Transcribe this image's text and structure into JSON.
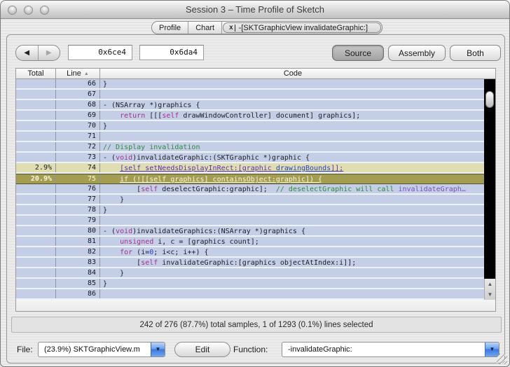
{
  "window": {
    "title": "Session 3 – Time Profile of Sketch"
  },
  "tabs": {
    "profile_label": "Profile",
    "chart_label": "Chart",
    "active_label": "-[SKTGraphicView invalidateGraphic:]",
    "close_icon": "x"
  },
  "nav": {
    "back_icon": "◀",
    "forward_icon": "▶",
    "start_address": "0x6ce4",
    "end_address": "0x6da4",
    "source_label": "Source",
    "assembly_label": "Assembly",
    "both_label": "Both"
  },
  "table": {
    "headers": {
      "total": "Total",
      "line": "Line",
      "sort_icon": "▲",
      "code": "Code"
    },
    "rows": [
      {
        "line": "66",
        "total": "",
        "style": "normal",
        "segs": [
          {
            "t": "}",
            "s": "p"
          }
        ]
      },
      {
        "line": "67",
        "total": "",
        "style": "normal",
        "segs": []
      },
      {
        "line": "68",
        "total": "",
        "style": "normal",
        "segs": [
          {
            "t": "- (NSArray *)graphics {",
            "s": "p"
          }
        ]
      },
      {
        "line": "69",
        "total": "",
        "style": "normal",
        "segs": [
          {
            "t": "    ",
            "s": "p"
          },
          {
            "t": "return",
            "s": "k"
          },
          {
            "t": " [[[",
            "s": "p"
          },
          {
            "t": "self",
            "s": "k"
          },
          {
            "t": " drawWindowController] document] graphics];",
            "s": "p"
          }
        ]
      },
      {
        "line": "70",
        "total": "",
        "style": "normal",
        "segs": [
          {
            "t": "}",
            "s": "p"
          }
        ]
      },
      {
        "line": "71",
        "total": "",
        "style": "normal",
        "segs": []
      },
      {
        "line": "72",
        "total": "",
        "style": "normal",
        "segs": [
          {
            "t": "// Display invalidation",
            "s": "c"
          }
        ]
      },
      {
        "line": "73",
        "total": "",
        "style": "normal",
        "segs": [
          {
            "t": "- (",
            "s": "p"
          },
          {
            "t": "void",
            "s": "k"
          },
          {
            "t": ")invalidateGraphic:(SKTGraphic *)graphic {",
            "s": "p"
          }
        ]
      },
      {
        "line": "74",
        "total": "2.9%",
        "style": "hot",
        "segs": [
          {
            "t": "    ",
            "s": "p"
          },
          {
            "t": "[self setNeedsDisplayInRect:[graphic ",
            "s": "u"
          },
          {
            "t": "drawingBounds",
            "s": "ub"
          },
          {
            "t": "]];",
            "s": "u"
          }
        ]
      },
      {
        "line": "75",
        "total": "20.9%",
        "style": "sel",
        "segs": [
          {
            "t": "    ",
            "s": "p"
          },
          {
            "t": "if (![[self graphics] containsObject:graphic]) {",
            "s": "su"
          }
        ]
      },
      {
        "line": "76",
        "total": "",
        "style": "normal",
        "segs": [
          {
            "t": "        [",
            "s": "p"
          },
          {
            "t": "self",
            "s": "k"
          },
          {
            "t": " deselectGraphic:graphic];  ",
            "s": "p"
          },
          {
            "t": "// deselectGraphic will call ",
            "s": "c"
          },
          {
            "t": "invalidateGraph…",
            "s": "v"
          }
        ]
      },
      {
        "line": "77",
        "total": "",
        "style": "normal",
        "segs": [
          {
            "t": "    }",
            "s": "p"
          }
        ]
      },
      {
        "line": "78",
        "total": "",
        "style": "normal",
        "segs": [
          {
            "t": "}",
            "s": "p"
          }
        ]
      },
      {
        "line": "79",
        "total": "",
        "style": "normal",
        "segs": []
      },
      {
        "line": "80",
        "total": "",
        "style": "normal",
        "segs": [
          {
            "t": "- (",
            "s": "p"
          },
          {
            "t": "void",
            "s": "k"
          },
          {
            "t": ")invalidateGraphics:(NSArray *)graphics {",
            "s": "p"
          }
        ]
      },
      {
        "line": "81",
        "total": "",
        "style": "normal",
        "segs": [
          {
            "t": "    ",
            "s": "p"
          },
          {
            "t": "unsigned",
            "s": "k"
          },
          {
            "t": " i, c = [graphics count];",
            "s": "p"
          }
        ]
      },
      {
        "line": "82",
        "total": "",
        "style": "normal",
        "segs": [
          {
            "t": "    ",
            "s": "p"
          },
          {
            "t": "for",
            "s": "k"
          },
          {
            "t": " (i=",
            "s": "p"
          },
          {
            "t": "0",
            "s": "n"
          },
          {
            "t": "; i<c; i++) {",
            "s": "p"
          }
        ]
      },
      {
        "line": "83",
        "total": "",
        "style": "normal",
        "segs": [
          {
            "t": "        [",
            "s": "p"
          },
          {
            "t": "self",
            "s": "k"
          },
          {
            "t": " invalidateGraphic:[graphics objectAtIndex:i]];",
            "s": "p"
          }
        ]
      },
      {
        "line": "84",
        "total": "",
        "style": "normal",
        "segs": [
          {
            "t": "    }",
            "s": "p"
          }
        ]
      },
      {
        "line": "85",
        "total": "",
        "style": "normal",
        "segs": [
          {
            "t": "}",
            "s": "p"
          }
        ]
      },
      {
        "line": "86",
        "total": "",
        "style": "normal",
        "segs": []
      }
    ]
  },
  "scrollbar": {
    "up_icon": "▲",
    "down_icon": "▼"
  },
  "status": {
    "text": "242 of 276 (87.7%) total samples, 1 of 1293 (0.1%) lines selected"
  },
  "footer": {
    "file_label": "File:",
    "file_value": "(23.9%) SKTGraphicView.m",
    "file_menu_icon": "▼",
    "edit_label": "Edit",
    "function_label": "Function:",
    "function_value": "-invalidateGraphic:",
    "function_menu_icon": "▼"
  },
  "colors": {
    "row_blue": "#c4cfe7",
    "hot_row_bg": "#dfddb1",
    "selected_row_bg": "#a39d52",
    "selected_row_border": "#55512a",
    "keyword": "#a5308c",
    "comment": "#2e8b3d",
    "link_purple": "#5b2fb8",
    "link_blue": "#2443c9",
    "scrollbar_track": "#000000",
    "popup_arrow_blue": "#3f76dc"
  }
}
